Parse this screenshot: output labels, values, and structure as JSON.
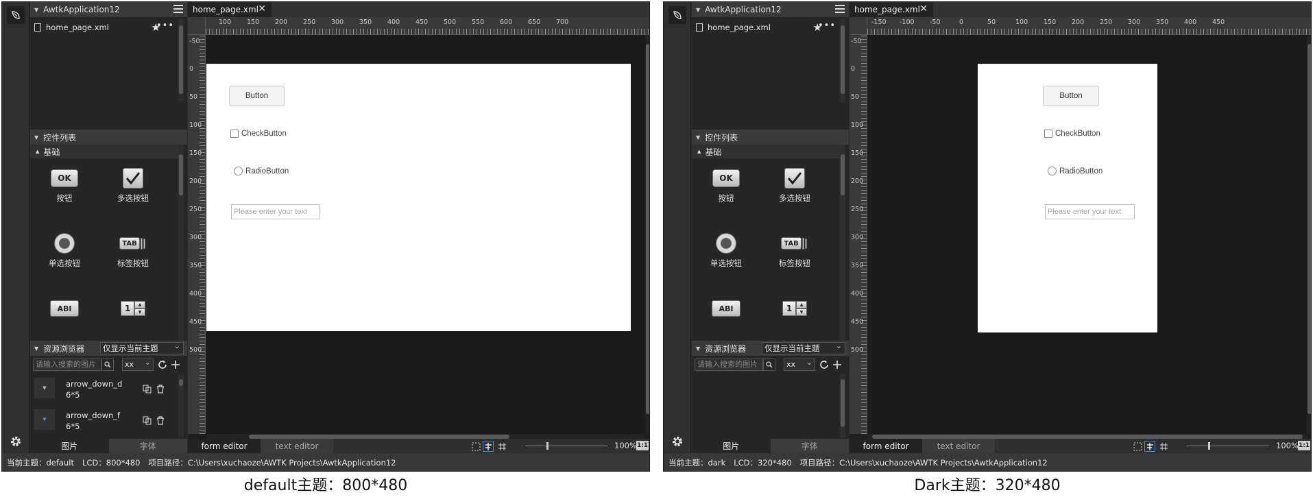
{
  "panels": [
    {
      "id": "left",
      "project_name": "AwtkApplication12",
      "file_name": "home_page.xml",
      "controls_header": "控件列表",
      "category_label": "基础",
      "widgets": [
        {
          "label": "按钮",
          "icon": "ok-button-icon",
          "glyph": "OK"
        },
        {
          "label": "多选按钮",
          "icon": "check-button-icon",
          "glyph": "✔"
        },
        {
          "label": "单选按钮",
          "icon": "radio-button-icon",
          "glyph": ""
        },
        {
          "label": "标签按钮",
          "icon": "tab-button-icon",
          "glyph": "TAB"
        },
        {
          "label": "",
          "icon": "edit-icon",
          "glyph": "AB"
        },
        {
          "label": "",
          "icon": "spin-box-icon",
          "glyph": "1"
        }
      ],
      "resource_header": "资源浏览器",
      "resource_filter": "仅显示当前主题",
      "search_placeholder": "请输入搜索的图片",
      "size_select": "xx",
      "resources": [
        {
          "name": "arrow_down_d",
          "size": "6*5"
        },
        {
          "name": "arrow_down_f",
          "size": "6*5"
        }
      ],
      "bottom_tab_images": "图片",
      "bottom_tab_fonts": "字体",
      "editor_tab": "home_page.xml",
      "ruler_top_labels": [
        "100",
        "150",
        "200",
        "250",
        "300",
        "350",
        "400",
        "450",
        "500",
        "550",
        "600",
        "650",
        "700"
      ],
      "ruler_left_labels": [
        "-50",
        "0",
        "50",
        "100",
        "150",
        "200",
        "250",
        "300",
        "350",
        "400",
        "450",
        "500"
      ],
      "lcd": {
        "button_label": "Button",
        "check_label": "CheckButton",
        "radio_label": "RadioButton",
        "edit_placeholder": "Please enter your text"
      },
      "mode_form": "form editor",
      "mode_text": "text editor",
      "zoom": "100%",
      "ratio_label": "1:1",
      "status_theme": "当前主题：default",
      "status_lcd": "LCD：800*480",
      "status_path": "项目路径：C:\\Users\\xuchaoze\\AWTK Projects\\AwtkApplication12",
      "caption": "default主题：800*480"
    },
    {
      "id": "right",
      "project_name": "AwtkApplication12",
      "file_name": "home_page.xml",
      "controls_header": "控件列表",
      "category_label": "基础",
      "widgets": [
        {
          "label": "按钮",
          "icon": "ok-button-icon",
          "glyph": "OK"
        },
        {
          "label": "多选按钮",
          "icon": "check-button-icon",
          "glyph": "✔"
        },
        {
          "label": "单选按钮",
          "icon": "radio-button-icon",
          "glyph": ""
        },
        {
          "label": "标签按钮",
          "icon": "tab-button-icon",
          "glyph": "TAB"
        },
        {
          "label": "",
          "icon": "edit-icon",
          "glyph": "AB"
        },
        {
          "label": "",
          "icon": "spin-box-icon",
          "glyph": "1"
        }
      ],
      "resource_header": "资源浏览器",
      "resource_filter": "仅显示当前主题",
      "search_placeholder": "请输入搜索的图片",
      "size_select": "xx",
      "resources": [],
      "bottom_tab_images": "图片",
      "bottom_tab_fonts": "字体",
      "editor_tab": "home_page.xml",
      "ruler_top_labels": [
        "-150",
        "-100",
        "-50",
        "0",
        "50",
        "100",
        "150",
        "200",
        "250",
        "300",
        "350",
        "400",
        "450"
      ],
      "ruler_left_labels": [
        "-50",
        "0",
        "50",
        "100",
        "150",
        "200",
        "250",
        "300",
        "350",
        "400",
        "450",
        "500"
      ],
      "lcd": {
        "button_label": "Button",
        "check_label": "CheckButton",
        "radio_label": "RadioButton",
        "edit_placeholder": "Please enter your text"
      },
      "mode_form": "form editor",
      "mode_text": "text editor",
      "zoom": "100%",
      "ratio_label": "1:1",
      "status_theme": "当前主题：dark",
      "status_lcd": "LCD：320*480",
      "status_path": "项目路径：C:\\Users\\xuchaoze\\AWTK Projects\\AwtkApplication12",
      "caption": "Dark主题：320*480"
    }
  ]
}
